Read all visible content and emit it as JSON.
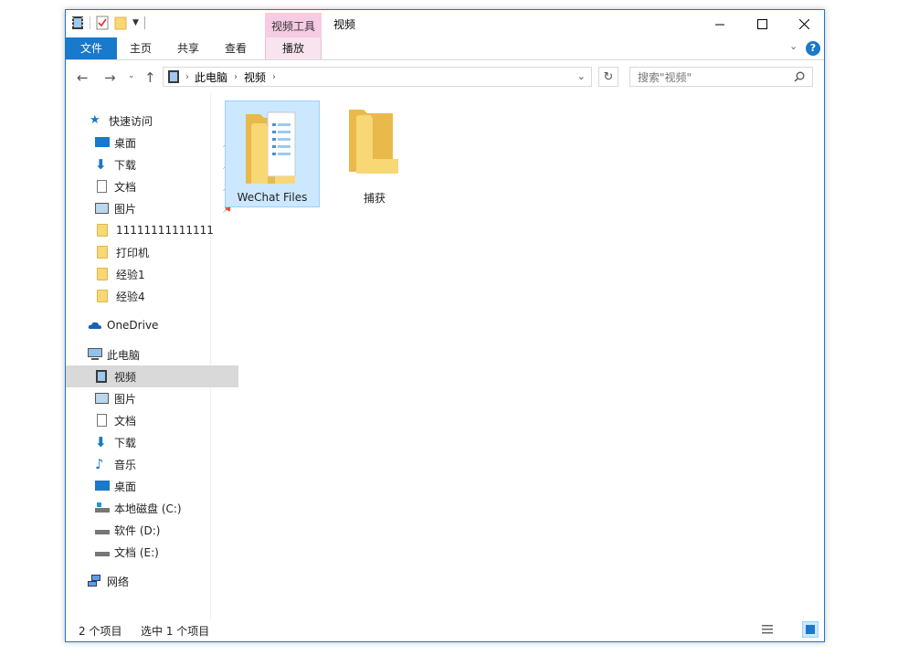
{
  "window": {
    "title": "视频",
    "tool_tab_header": "视频工具"
  },
  "ribbon": {
    "tabs": [
      "文件",
      "主页",
      "共享",
      "查看",
      "播放"
    ]
  },
  "address": {
    "segments": [
      "此电脑",
      "视频"
    ]
  },
  "search": {
    "placeholder": "搜索\"视频\""
  },
  "nav": {
    "quick_access": "快速访问",
    "pinned": [
      {
        "label": "桌面"
      },
      {
        "label": "下载"
      },
      {
        "label": "文档"
      },
      {
        "label": "图片"
      }
    ],
    "recent": [
      {
        "label": "11111111111111"
      },
      {
        "label": "打印机"
      },
      {
        "label": "经验1"
      },
      {
        "label": "经验4"
      }
    ],
    "onedrive": "OneDrive",
    "this_pc": "此电脑",
    "pc_items": [
      {
        "label": "视频"
      },
      {
        "label": "图片"
      },
      {
        "label": "文档"
      },
      {
        "label": "下载"
      },
      {
        "label": "音乐"
      },
      {
        "label": "桌面"
      },
      {
        "label": "本地磁盘 (C:)"
      },
      {
        "label": "软件 (D:)"
      },
      {
        "label": "文档 (E:)"
      }
    ],
    "network": "网络"
  },
  "files": [
    {
      "name": "WeChat Files"
    },
    {
      "name": "捕获"
    }
  ],
  "status": {
    "count": "2 个项目",
    "selected": "选中 1 个项目"
  },
  "colors": {
    "accent": "#1979ca",
    "tool_tab": "#f6cbe3",
    "selection": "#cce8ff",
    "folder": "#f8d775"
  }
}
